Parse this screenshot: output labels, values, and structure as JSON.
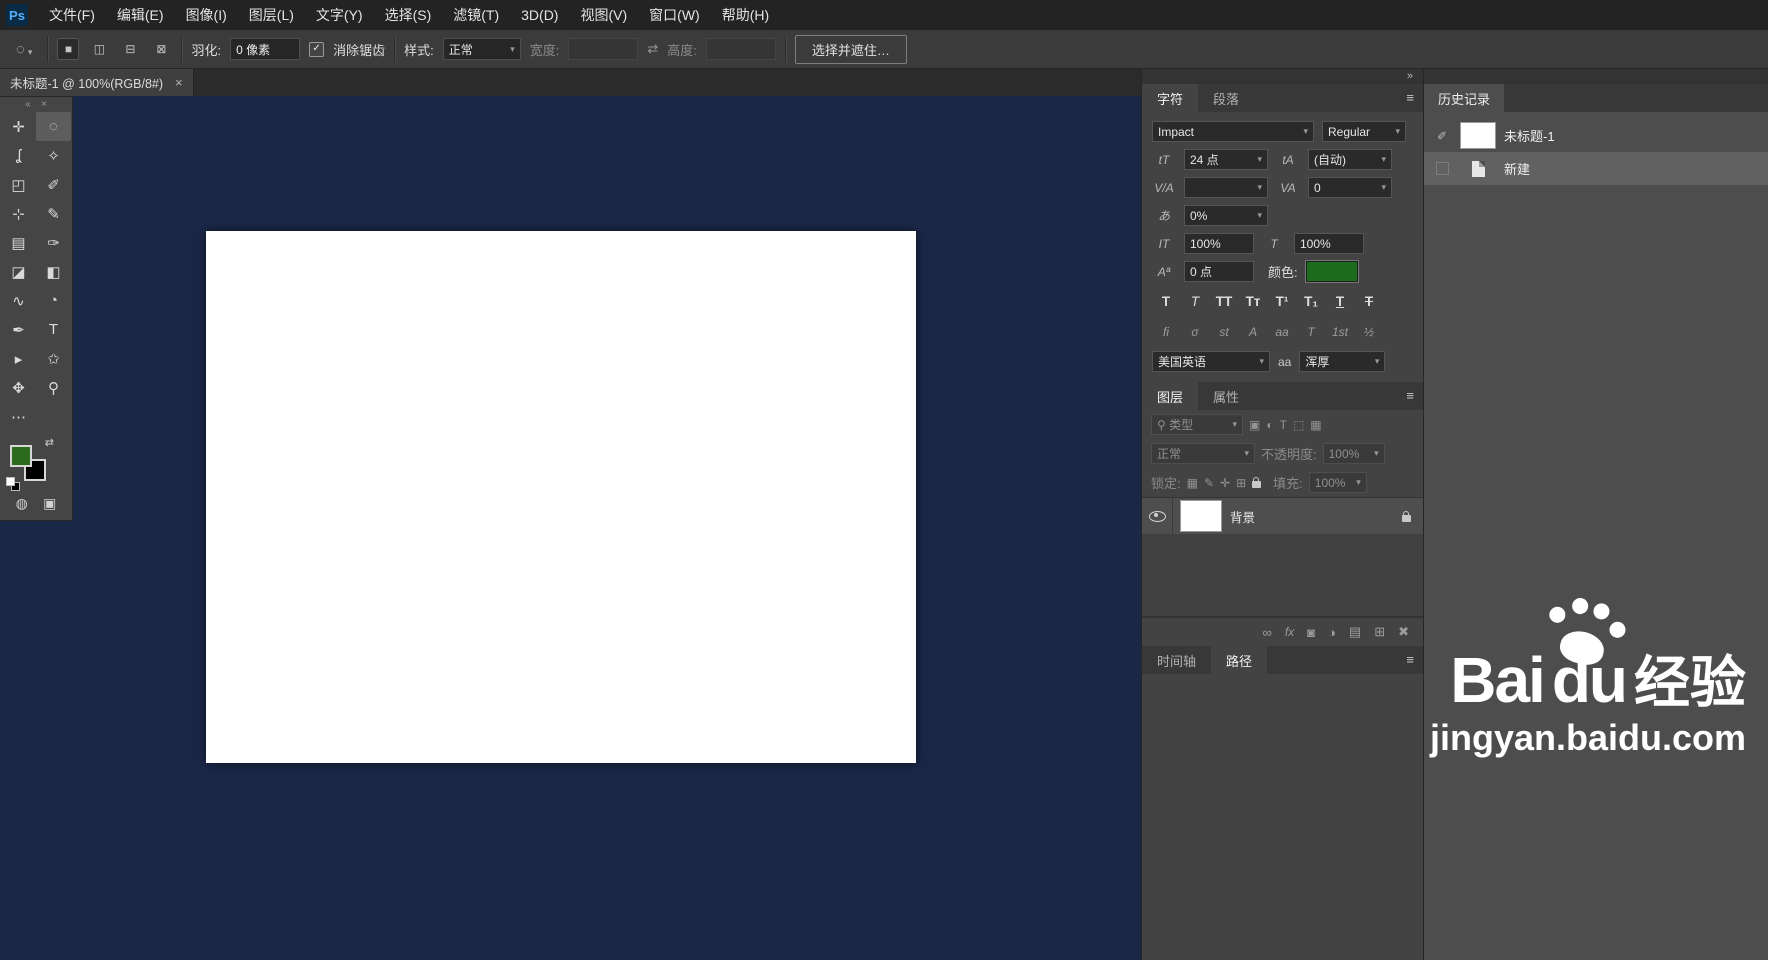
{
  "colors": {
    "foreground_green": "#2a6b1d",
    "text_color_swatch": "#1d6b1d",
    "canvas_workspace": "#1a2747"
  },
  "icons": {
    "caret": "▾",
    "menu": "≡",
    "collapse_right": "»",
    "collapse_left": "«",
    "close": "×",
    "grip": "⋯",
    "swap": "⇄",
    "check": "✓",
    "search": "⚲",
    "tool_preset": "◌",
    "link": "∞",
    "fx": "fx",
    "layer_mask": "◙",
    "adjustment": "◑",
    "group": "▤",
    "new_layer": "⊞",
    "trash": "✖",
    "history_source": "✐"
  },
  "menubar": {
    "logo": "Ps",
    "items": [
      "文件(F)",
      "编辑(E)",
      "图像(I)",
      "图层(L)",
      "文字(Y)",
      "选择(S)",
      "滤镜(T)",
      "3D(D)",
      "视图(V)",
      "窗口(W)",
      "帮助(H)"
    ]
  },
  "optionsbar": {
    "selection_modes": [
      "■",
      "◫",
      "⊟",
      "⊠"
    ],
    "feather_label": "羽化:",
    "feather_value": "0 像素",
    "antialias_label": "消除锯齿",
    "style_label": "样式:",
    "style_value": "正常",
    "width_label": "宽度:",
    "width_value": "",
    "height_label": "高度:",
    "height_value": "",
    "select_mask_button": "选择并遮住…"
  },
  "tabstrip": {
    "doc_title": "未标题-1 @ 100%(RGB/8#)"
  },
  "toolbar": {
    "tools": [
      {
        "name": "move",
        "glyph": "✛"
      },
      {
        "name": "elliptical-marquee",
        "glyph": "◌",
        "selected": true
      },
      {
        "name": "lasso",
        "glyph": "ʆ"
      },
      {
        "name": "quick-selection",
        "glyph": "✧"
      },
      {
        "name": "crop",
        "glyph": "◰"
      },
      {
        "name": "eyedropper",
        "glyph": "✐"
      },
      {
        "name": "spot-healing-brush",
        "glyph": "⊹"
      },
      {
        "name": "brush",
        "glyph": "✎"
      },
      {
        "name": "clone-stamp",
        "glyph": "▤"
      },
      {
        "name": "history-brush",
        "glyph": "✑"
      },
      {
        "name": "eraser",
        "glyph": "◪"
      },
      {
        "name": "paint-bucket",
        "glyph": "◧"
      },
      {
        "name": "smudge",
        "glyph": "∿"
      },
      {
        "name": "dodge",
        "glyph": "◔"
      },
      {
        "name": "pen",
        "glyph": "✒"
      },
      {
        "name": "type",
        "glyph": "T"
      },
      {
        "name": "path-selection",
        "glyph": "▸"
      },
      {
        "name": "shape",
        "glyph": "✩"
      },
      {
        "name": "hand",
        "glyph": "✥"
      },
      {
        "name": "zoom",
        "glyph": "⚲"
      },
      {
        "name": "more-tools",
        "glyph": "⋯"
      }
    ],
    "quick_mask_glyph": "◍",
    "screen_mode_glyph": "▣"
  },
  "character": {
    "tab_character": "字符",
    "tab_paragraph": "段落",
    "font_family": "Impact",
    "font_style": "Regular",
    "size_icon": "tT",
    "size_value": "24 点",
    "leading_icon": "tA",
    "leading_value": "(自动)",
    "kerning_icon": "V/A",
    "kerning_value": "",
    "tracking_icon": "VA",
    "tracking_value": "0",
    "prop_icon": "あ",
    "prop_value": "0%",
    "vscale_icon": "IT",
    "vscale_value": "100%",
    "hscale_icon": "T",
    "hscale_value": "100%",
    "baseline_icon": "Aª",
    "baseline_value": "0 点",
    "color_label": "颜色:",
    "t_buttons": [
      "T",
      "T",
      "TT",
      "Tᴛ",
      "T¹",
      "T₁",
      "T",
      "T"
    ],
    "lig_buttons": [
      "fi",
      "σ",
      "st",
      "A",
      "aa",
      "T",
      "1st",
      "½"
    ],
    "language_value": "美国英语",
    "aa_icon": "aa",
    "smoothing_value": "浑厚"
  },
  "layers": {
    "tab_layers": "图层",
    "tab_properties": "属性",
    "filter_label": "类型",
    "filter_icons": [
      "▣",
      "◐",
      "T",
      "⬚",
      "▦"
    ],
    "blend_value": "正常",
    "opacity_label": "不透明度:",
    "opacity_value": "100%",
    "lock_label": "锁定:",
    "lock_icons": [
      "▦",
      "✎",
      "✛",
      "⊞"
    ],
    "fill_label": "填充:",
    "fill_value": "100%",
    "layer_name": "背景"
  },
  "bottom_tabs": {
    "timeline": "时间轴",
    "paths": "路径"
  },
  "history": {
    "title": "历史记录",
    "item1": "未标题-1",
    "item2": "新建"
  },
  "watermark": {
    "bai": "Bai",
    "du": "du",
    "cn": "经验",
    "url": "jingyan.baidu.com"
  }
}
